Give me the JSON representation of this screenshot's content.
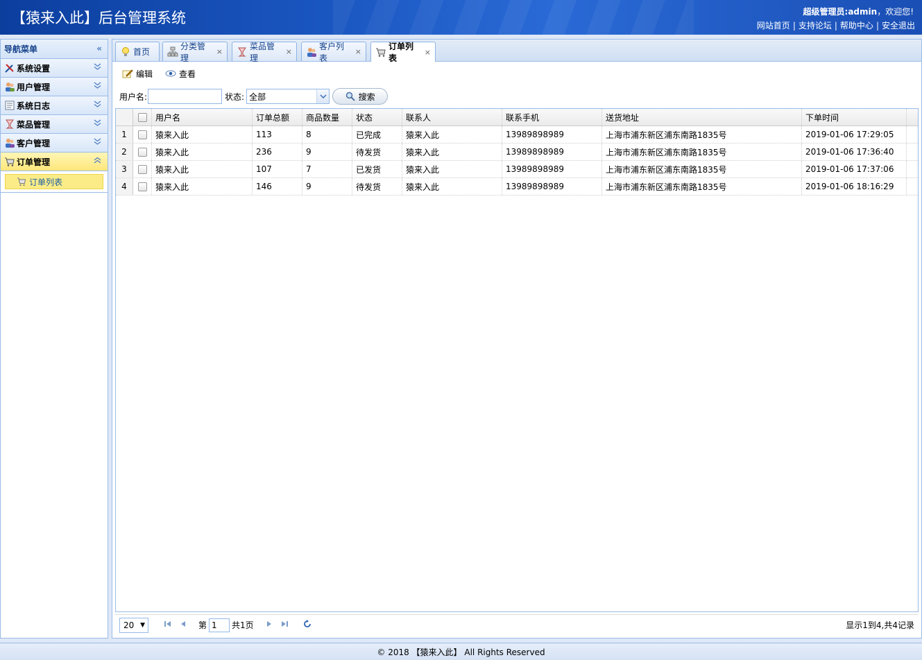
{
  "header": {
    "title": "【猿来入此】后台管理系统",
    "user_prefix": "超级管理员:admin",
    "user_suffix": "，欢迎您!",
    "links": [
      "网站首页",
      "支持论坛",
      "帮助中心",
      "安全退出"
    ]
  },
  "nav": {
    "title": "导航菜单",
    "items": [
      {
        "label": "系统设置",
        "icon": "tools-icon"
      },
      {
        "label": "用户管理",
        "icon": "users-icon"
      },
      {
        "label": "系统日志",
        "icon": "log-icon"
      },
      {
        "label": "菜品管理",
        "icon": "goblet-icon"
      },
      {
        "label": "客户管理",
        "icon": "customers-icon"
      },
      {
        "label": "订单管理",
        "icon": "cart-icon"
      }
    ],
    "sub_items": [
      {
        "label": "订单列表",
        "icon": "cart-icon"
      }
    ]
  },
  "tabs": [
    {
      "label": "首页",
      "closable": false
    },
    {
      "label": "分类管理",
      "closable": true
    },
    {
      "label": "菜品管理",
      "closable": true
    },
    {
      "label": "客户列表",
      "closable": true
    },
    {
      "label": "订单列表",
      "closable": true,
      "active": true
    }
  ],
  "toolbar": {
    "edit_label": "编辑",
    "view_label": "查看"
  },
  "search": {
    "username_label": "用户名:",
    "username_value": "",
    "status_label": "状态:",
    "status_value": "全部",
    "search_label": "搜索"
  },
  "grid": {
    "columns": [
      "用户名",
      "订单总额",
      "商品数量",
      "状态",
      "联系人",
      "联系手机",
      "送货地址",
      "下单时间"
    ],
    "rows": [
      {
        "num": "1",
        "user": "猿来入此",
        "total": "113",
        "qty": "8",
        "status": "已完成",
        "contact": "猿来入此",
        "phone": "13989898989",
        "address": "上海市浦东新区浦东南路1835号",
        "time": "2019-01-06 17:29:05"
      },
      {
        "num": "2",
        "user": "猿来入此",
        "total": "236",
        "qty": "9",
        "status": "待发货",
        "contact": "猿来入此",
        "phone": "13989898989",
        "address": "上海市浦东新区浦东南路1835号",
        "time": "2019-01-06 17:36:40"
      },
      {
        "num": "3",
        "user": "猿来入此",
        "total": "107",
        "qty": "7",
        "status": "已发货",
        "contact": "猿来入此",
        "phone": "13989898989",
        "address": "上海市浦东新区浦东南路1835号",
        "time": "2019-01-06 17:37:06"
      },
      {
        "num": "4",
        "user": "猿来入此",
        "total": "146",
        "qty": "9",
        "status": "待发货",
        "contact": "猿来入此",
        "phone": "13989898989",
        "address": "上海市浦东新区浦东南路1835号",
        "time": "2019-01-06 18:16:29"
      }
    ]
  },
  "pager": {
    "page_size": "20",
    "page_prefix": "第",
    "page_value": "1",
    "page_total": "共1页",
    "info": "显示1到4,共4记录"
  },
  "footer": {
    "text": "© 2018 【猿来入此】 All Rights Reserved"
  }
}
